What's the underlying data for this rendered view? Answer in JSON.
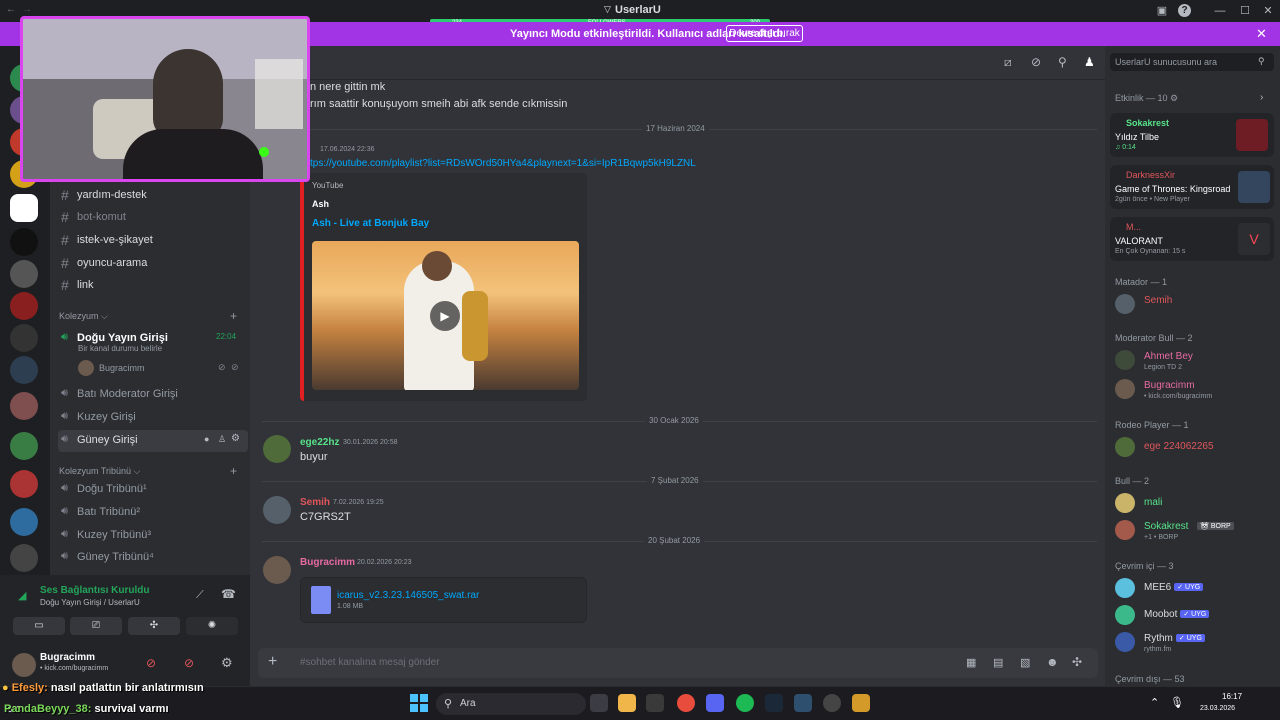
{
  "window": {
    "title": "UserlarU",
    "follow_left": "234",
    "follow_label": "FOLLOWERS",
    "follow_right": "300"
  },
  "notice": {
    "text": "Yayıncı Modu etkinleştirildi. Kullanıcı adları kısaltıldı.",
    "button": "Devre dışı bırak"
  },
  "sidebar": {
    "channels": [
      {
        "name": "yardım-destek"
      },
      {
        "name": "bot-komut"
      },
      {
        "name": "istek-ve-şikayet"
      },
      {
        "name": "oyuncu-arama"
      },
      {
        "name": "link"
      }
    ],
    "category1": "Kolezyum",
    "voice_active": {
      "name": "Doğu Yayın Girişi",
      "time": "22:04",
      "status": "Bir kanal durumu belirle",
      "user": "Bugracimm"
    },
    "voice_channels": [
      "Batı Moderator Girişi",
      "Kuzey Girişi",
      "Güney Girişi"
    ],
    "category2": "Kolezyum Tribünü",
    "tribune_channels": [
      "Doğu Tribünü¹",
      "Batı Tribünü²",
      "Kuzey Tribünü³",
      "Güney Tribünü⁴"
    ],
    "voice_panel": {
      "status": "Ses Bağlantısı Kuruldu",
      "location": "Doğu Yayın Girişi / UserlarU"
    },
    "user": {
      "name": "Bugracimm",
      "sub": "• kick.com/bugracimm"
    }
  },
  "chat": {
    "top_lines": [
      "n nere gittin mk",
      "rım saattir konuşuyom smeih abi afk sende cıkmissin"
    ],
    "date1": "17 Haziran 2024",
    "link_ts": "17.06.2024 22:36",
    "link": "tps://youtube.com/playlist?list=RDsWOrd50HYa4&playnext=1&si=IpR1Bqwp5kH9LZNL",
    "embed": {
      "provider": "YouTube",
      "author": "Ash",
      "title": "Ash - Live at Bonjuk Bay"
    },
    "date2": "30 Ocak 2026",
    "msg1": {
      "author": "ege22hz",
      "ts": "30.01.2026 20:58",
      "text": "buyur"
    },
    "date3": "7 Şubat 2026",
    "msg2": {
      "author": "Semih",
      "ts": "7.02.2026 19:25",
      "text": "C7GRS2T"
    },
    "date4": "20 Şubat 2026",
    "msg3": {
      "author": "Bugracimm",
      "ts": "20.02.2026 20:23"
    },
    "file": {
      "name": "icarus_v2.3.23.146505_swat.rar",
      "size": "1.08 MB"
    },
    "composer_placeholder": "#sohbet kanalına mesaj gönder"
  },
  "members": {
    "search_placeholder": "UserlarU sunucusunu ara",
    "activity_header": "Etkinlik — 10",
    "activities": [
      {
        "user": "Sokakrest",
        "title": "Yıldız Tilbe",
        "sub": "♫ 0:14"
      },
      {
        "user": "DarknessXir",
        "title": "Game of Thrones: Kingsroad",
        "sub": "2gün önce  •  New Player"
      },
      {
        "user": "M...",
        "title": "VALORANT",
        "sub": "En Çok Oynanan: 15 s"
      }
    ],
    "groups": [
      {
        "label": "Matador — 1",
        "members": [
          {
            "name": "Semih",
            "sub": "",
            "color": "#e0565b"
          }
        ]
      },
      {
        "label": "Moderator Bull — 2",
        "members": [
          {
            "name": "Ahmet Bey",
            "sub": "Legion TD 2",
            "color": "#e86aa3"
          },
          {
            "name": "Bugracimm",
            "sub": "• kick.com/bugracimm",
            "color": "#e86aa3"
          }
        ]
      },
      {
        "label": "Rodeo Player — 1",
        "members": [
          {
            "name": "ege 224062265",
            "sub": "",
            "color": "#e0565b"
          }
        ]
      },
      {
        "label": "Bull — 2",
        "members": [
          {
            "name": "mali",
            "sub": "",
            "color": "#57e389"
          },
          {
            "name": "Sokakrest",
            "sub": "+1 • BORP",
            "color": "#57e389",
            "tag": "BORP"
          }
        ]
      },
      {
        "label": "Çevrim içi — 3",
        "members": [
          {
            "name": "MEE6",
            "sub": "",
            "color": "#dbdee1",
            "badge": "✓ UYG"
          },
          {
            "name": "Moobot",
            "sub": "",
            "color": "#dbdee1",
            "badge": "✓ UYG"
          },
          {
            "name": "Rythm",
            "sub": "rythm.fm",
            "color": "#dbdee1",
            "badge": "✓ UYG"
          }
        ]
      }
    ],
    "offline": "Çevrim dışı — 53"
  },
  "taskbar": {
    "weather": "9°C",
    "search": "Ara",
    "time": "16:17",
    "date": "23.03.2026"
  },
  "overlay_chat": [
    {
      "user": "Efesly:",
      "text": "nasıl patlattın bir anlatırmısın"
    },
    {
      "user": "PandaBeyyy_38:",
      "text": "survival varmı"
    }
  ]
}
